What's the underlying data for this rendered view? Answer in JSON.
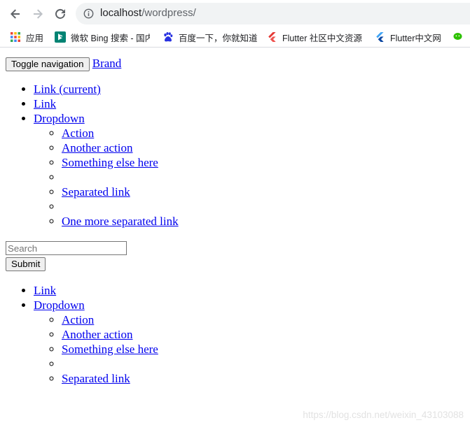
{
  "browser": {
    "url_host": "localhost",
    "url_path": "/wordpress/",
    "bookmarks": [
      {
        "label": "应用",
        "icon": "apps-grid-icon"
      },
      {
        "label": "微软 Bing 搜索 - 国内",
        "icon": "bing-icon"
      },
      {
        "label": "百度一下，你就知道",
        "icon": "baidu-paw-icon"
      },
      {
        "label": "Flutter 社区中文资源",
        "icon": "flutter-icon"
      },
      {
        "label": "Flutter中文网",
        "icon": "flutter-icon"
      },
      {
        "label": "",
        "icon": "wechat-icon"
      }
    ]
  },
  "page": {
    "toggle_label": "Toggle navigation",
    "brand": "Brand",
    "nav1": {
      "link_current": "Link (current)",
      "link": "Link",
      "dropdown": "Dropdown",
      "menu": [
        "Action",
        "Another action",
        "Something else here",
        "",
        "Separated link",
        "",
        "One more separated link"
      ]
    },
    "search_placeholder": "Search",
    "submit_label": "Submit",
    "nav2": {
      "link": "Link",
      "dropdown": "Dropdown",
      "menu": [
        "Action",
        "Another action",
        "Something else here",
        "",
        "Separated link"
      ]
    },
    "watermark": "https://blog.csdn.net/weixin_43103088"
  },
  "colors": {
    "link": "#0000ee",
    "omnibox_bg": "#f1f3f4",
    "bing": "#008373",
    "baidu": "#2932e1",
    "flutter": "#42a5f5",
    "wechat": "#2dc100"
  }
}
